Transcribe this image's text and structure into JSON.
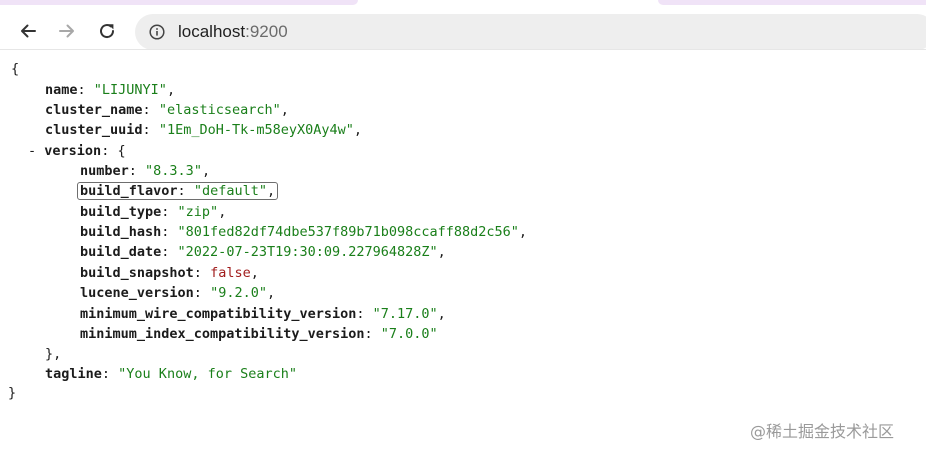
{
  "browser": {
    "url_host": "localhost",
    "url_port": ":9200",
    "icons": {
      "back": "arrow-left-icon",
      "forward": "arrow-right-icon",
      "reload": "reload-icon",
      "site_info": "info-icon"
    }
  },
  "json": {
    "open_brace": "{",
    "close_brace": "}",
    "collapse_marker": "-",
    "name": {
      "key": "name",
      "value": "\"LIJUNYI\""
    },
    "cluster_name": {
      "key": "cluster_name",
      "value": "\"elasticsearch\""
    },
    "cluster_uuid": {
      "key": "cluster_uuid",
      "value": "\"1Em_DoH-Tk-m58eyX0Ay4w\""
    },
    "version": {
      "key": "version",
      "open": "{",
      "close": "},",
      "number": {
        "key": "number",
        "value": "\"8.3.3\""
      },
      "build_flavor": {
        "key": "build_flavor",
        "value": "\"default\""
      },
      "build_type": {
        "key": "build_type",
        "value": "\"zip\""
      },
      "build_hash": {
        "key": "build_hash",
        "value": "\"801fed82df74dbe537f89b71b098ccaff88d2c56\""
      },
      "build_date": {
        "key": "build_date",
        "value": "\"2022-07-23T19:30:09.227964828Z\""
      },
      "build_snapshot": {
        "key": "build_snapshot",
        "value": "false"
      },
      "lucene_version": {
        "key": "lucene_version",
        "value": "\"9.2.0\""
      },
      "minimum_wire_compatibility_version": {
        "key": "minimum_wire_compatibility_version",
        "value": "\"7.17.0\""
      },
      "minimum_index_compatibility_version": {
        "key": "minimum_index_compatibility_version",
        "value": "\"7.0.0\""
      }
    },
    "tagline": {
      "key": "tagline",
      "value": "\"You Know, for Search\""
    }
  },
  "watermark": "@稀土掘金技术社区",
  "colors": {
    "string": "#1a7f1a",
    "boolean": "#a11d1d",
    "key": "#1b1b1b",
    "tab_accent": "#f0e3f7",
    "omnibox": "#eeeeee"
  }
}
